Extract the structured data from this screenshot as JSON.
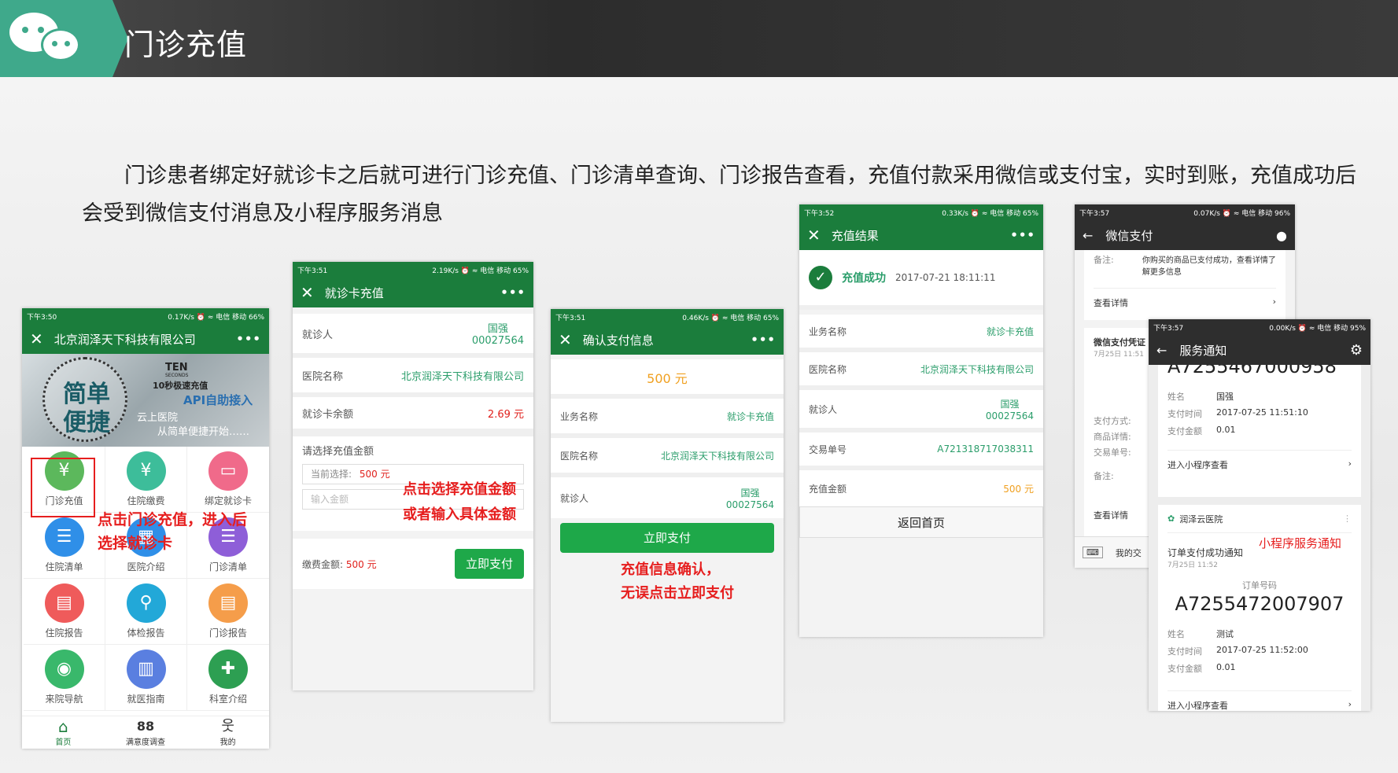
{
  "header": {
    "title": "门诊充值"
  },
  "intro": "门诊患者绑定好就诊卡之后就可进行门诊充值、门诊清单查询、门诊报告查看，充值付款采用微信或支付宝，实时到账，充值成功后会受到微信支付消息及小程序服务消息",
  "colors": {
    "brand_green": "#1b7d3c",
    "accent": "#3fa98b",
    "annotation_red": "#e61e1e"
  },
  "screen1": {
    "status": {
      "time": "下午3:50",
      "right": "0.17K/s ⏰ ≈ 电信 移动 66%"
    },
    "title": "北京润泽天下科技有限公司",
    "close": "✕",
    "more": "•••",
    "banner": {
      "line1": "简单",
      "line2": "便捷",
      "ten": "TEN",
      "seconds": "SECONDS",
      "fast": "10秒极速充值",
      "api": "API自助接入",
      "cloud": "云上医院",
      "slogan": "从简单便捷开始……"
    },
    "icons": [
      {
        "label": "门诊充值",
        "icon": "yen-icon",
        "color": "#5cb85c",
        "glyph": "¥"
      },
      {
        "label": "住院缴费",
        "icon": "yen-icon",
        "color": "#3dbd9a",
        "glyph": "¥"
      },
      {
        "label": "绑定就诊卡",
        "icon": "card-icon",
        "color": "#f06a8a",
        "glyph": "▭"
      },
      {
        "label": "住院清单",
        "icon": "list-icon",
        "color": "#2f8fe8",
        "glyph": "☰"
      },
      {
        "label": "医院介绍",
        "icon": "building-icon",
        "color": "#2f8fe8",
        "glyph": "▦"
      },
      {
        "label": "门诊清单",
        "icon": "list-icon",
        "color": "#8e5ed8",
        "glyph": "☰"
      },
      {
        "label": "住院报告",
        "icon": "report-icon",
        "color": "#ef5b5b",
        "glyph": "▤"
      },
      {
        "label": "体检报告",
        "icon": "microscope-icon",
        "color": "#22a8d8",
        "glyph": "⚲"
      },
      {
        "label": "门诊报告",
        "icon": "report-icon",
        "color": "#f59d4a",
        "glyph": "▤"
      },
      {
        "label": "来院导航",
        "icon": "location-icon",
        "color": "#39b86b",
        "glyph": "◉"
      },
      {
        "label": "就医指南",
        "icon": "guide-icon",
        "color": "#5a7fe0",
        "glyph": "▥"
      },
      {
        "label": "科室介绍",
        "icon": "medical-icon",
        "color": "#2d9f52",
        "glyph": "✚"
      }
    ],
    "tabs": [
      {
        "label": "首页",
        "icon": "home-icon",
        "glyph": "⌂"
      },
      {
        "label": "满意度调查",
        "icon": "grid-icon",
        "glyph": "88"
      },
      {
        "label": "我的",
        "icon": "user-icon",
        "glyph": "웃"
      }
    ]
  },
  "screen2": {
    "status": {
      "time": "下午3:51",
      "right": "2.19K/s ⏰ ≈ 电信 移动 65%"
    },
    "title": "就诊卡充值",
    "close": "✕",
    "more": "•••",
    "patient_label": "就诊人",
    "patient_name": "国强",
    "patient_id": "00027564",
    "hospital_label": "医院名称",
    "hospital_value": "北京润泽天下科技有限公司",
    "balance_label": "就诊卡余额",
    "balance_value": "2.69 元",
    "amount_title": "请选择充值金额",
    "current_label": "当前选择:",
    "current_value": "500 元",
    "input_placeholder": "输入金额",
    "fee_label": "缴费金额:",
    "fee_value": "500 元",
    "pay_button": "立即支付"
  },
  "screen3": {
    "status": {
      "time": "下午3:51",
      "right": "0.46K/s ⏰ ≈ 电信 移动 65%"
    },
    "title": "确认支付信息",
    "close": "✕",
    "more": "•••",
    "amount": "500 元",
    "biz_label": "业务名称",
    "biz_value": "就诊卡充值",
    "hospital_label": "医院名称",
    "hospital_value": "北京润泽天下科技有限公司",
    "patient_label": "就诊人",
    "patient_name": "国强",
    "patient_id": "00027564",
    "pay_button": "立即支付"
  },
  "screen4": {
    "status": {
      "time": "下午3:52",
      "right": "0.33K/s ⏰ ≈ 电信 移动 65%"
    },
    "title": "充值结果",
    "close": "✕",
    "more": "•••",
    "success": "充值成功",
    "success_time": "2017-07-21 18:11:11",
    "biz_label": "业务名称",
    "biz_value": "就诊卡充值",
    "hospital_label": "医院名称",
    "hospital_value": "北京润泽天下科技有限公司",
    "patient_label": "就诊人",
    "patient_name": "国强",
    "patient_id": "00027564",
    "trade_label": "交易单号",
    "trade_value": "A721318717038311",
    "amount_label": "充值金额",
    "amount_value": "500 元",
    "home_button": "返回首页"
  },
  "screen5": {
    "status": {
      "time": "下午3:57",
      "right": "0.07K/s ⏰ ≈ 电信 移动 96%"
    },
    "title": "微信支付",
    "note_label": "备注:",
    "note_value": "你购买的商品已支付成功，查看详情了解更多信息",
    "detail": "查看详情",
    "voucher": "微信支付凭证",
    "voucher_date": "7月25日 11:51",
    "pay_method": "支付方式:",
    "goods": "商品详情:",
    "trade_no": "交易单号:",
    "note2": "备注:",
    "detail2": "查看详情",
    "my_label": "我的交"
  },
  "screen6": {
    "status": {
      "time": "下午3:57",
      "right": "0.00K/s ⏰ ≈ 电信 移动 95%"
    },
    "title": "服务通知",
    "top_order": "A7255467000958",
    "n1": {
      "name_label": "姓名",
      "name": "国强",
      "time_label": "支付时间",
      "time": "2017-07-25 11:51:10",
      "amt_label": "支付金额",
      "amt": "0.01",
      "enter": "进入小程序查看"
    },
    "hospital": "润泽云医院",
    "notice_title": "订单支付成功通知",
    "notice_date": "7月25日 11:52",
    "order_label": "订单号码",
    "order_no": "A7255472007907",
    "n2": {
      "name_label": "姓名",
      "name": "测试",
      "time_label": "支付时间",
      "time": "2017-07-25 11:52:00",
      "amt_label": "支付金额",
      "amt": "0.01",
      "enter": "进入小程序查看"
    }
  },
  "annotations": {
    "a1_l1": "点击门诊充值，进入后",
    "a1_l2": "选择就诊卡",
    "a2": "点击选择充值金额",
    "a3": "或者输入具体金额",
    "a4_l1": "充值信息确认，",
    "a4_l2": "无误点击立即支付",
    "a5": "小程序服务通知"
  }
}
